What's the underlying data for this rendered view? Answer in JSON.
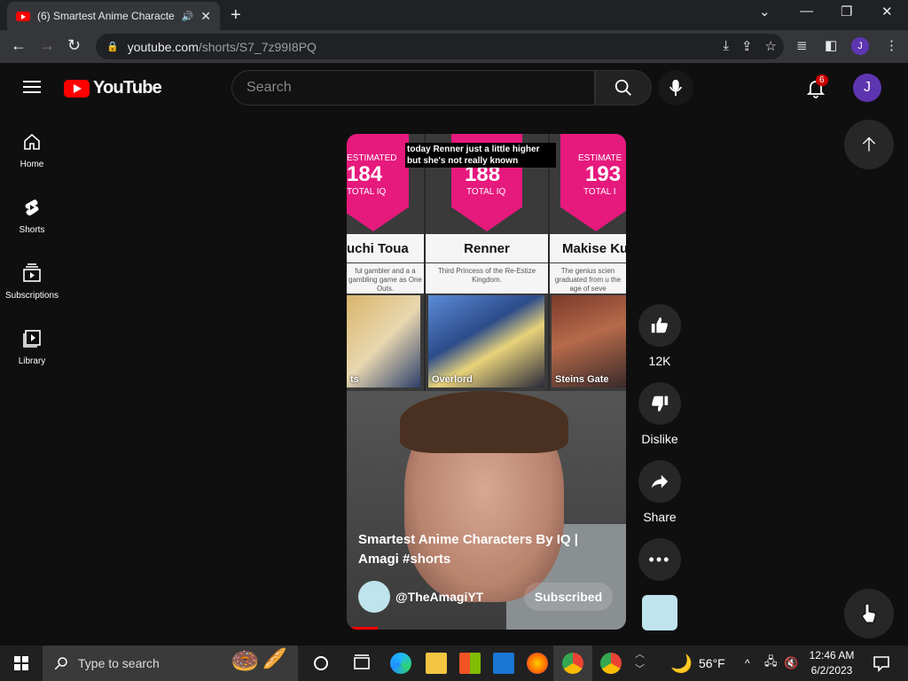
{
  "browser": {
    "tab_title": "(6) Smartest Anime Characte",
    "url_host": "youtube.com",
    "url_path": "/shorts/S7_7z99I8PQ"
  },
  "header": {
    "logo_text": "YouTube",
    "search_placeholder": "Search",
    "notification_count": "6",
    "avatar_letter": "J"
  },
  "sidebar": {
    "items": [
      {
        "label": "Home",
        "icon": "home-icon"
      },
      {
        "label": "Shorts",
        "icon": "shorts-icon"
      },
      {
        "label": "Subscriptions",
        "icon": "subscriptions-icon"
      },
      {
        "label": "Library",
        "icon": "library-icon"
      }
    ]
  },
  "short": {
    "caption": "today Renner just a little higher but she's not really known",
    "characters": [
      {
        "estimated": "ESTIMATED",
        "iq": "184",
        "total": "TOTAL IQ",
        "name": "uchi Toua",
        "desc": "ful gambler and a a gambling game as One Outs.",
        "anime": "ts"
      },
      {
        "estimated": "D",
        "iq": "188",
        "total": "TOTAL IQ",
        "name": "Renner",
        "desc": "Third Princess of the Re-Estize Kingdom.",
        "anime": "Overlord"
      },
      {
        "estimated": "ESTIMATE",
        "iq": "193",
        "total": "TOTAL I",
        "name": "Makise Ku",
        "desc": "The genius scien graduated from u the age of seve",
        "anime": "Steins Gate"
      }
    ],
    "title": "Smartest Anime Characters By IQ | Amagi #shorts",
    "channel": "@TheAmagiYT",
    "subscribe_label": "Subscribed",
    "progress": 0.11
  },
  "actions": {
    "like_count": "12K",
    "dislike_label": "Dislike",
    "share_label": "Share"
  },
  "taskbar": {
    "search_placeholder": "Type to search",
    "weather": "56°F",
    "time": "12:46 AM",
    "date": "6/2/2023"
  }
}
